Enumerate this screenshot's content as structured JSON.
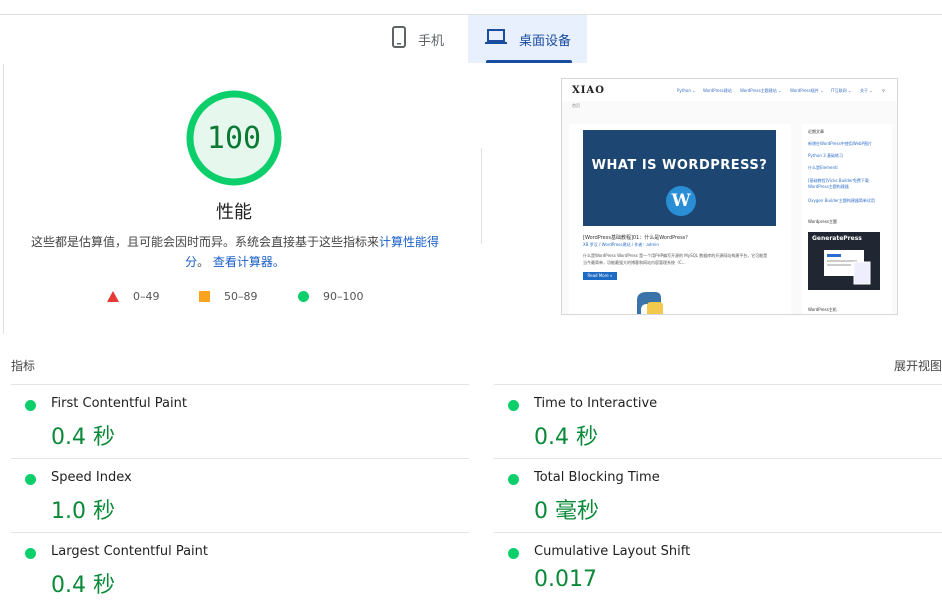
{
  "tabs": {
    "mobile_label": "手机",
    "desktop_label": "桌面设备"
  },
  "score": {
    "value": "100",
    "title": "性能",
    "desc_prefix": "这些都是估算值，且可能会因时而异。系统会直接基于这些指标来",
    "desc_link": "计算性能得分",
    "desc_mid": "。",
    "desc_link2": "查看计算器。"
  },
  "legend": [
    {
      "label": "0–49",
      "color": "#e53935",
      "shape": "triangle"
    },
    {
      "label": "50–89",
      "color": "#fba31e",
      "shape": "square"
    },
    {
      "label": "90–100",
      "color": "#0cce6b",
      "shape": "circle"
    }
  ],
  "metrics_header": {
    "title": "指标",
    "expand": "展开视图"
  },
  "metrics": [
    {
      "name": "First Contentful Paint",
      "value": "0.4 秒"
    },
    {
      "name": "Time to Interactive",
      "value": "0.4 秒"
    },
    {
      "name": "Speed Index",
      "value": "1.0 秒"
    },
    {
      "name": "Total Blocking Time",
      "value": "0 毫秒"
    },
    {
      "name": "Largest Contentful Paint",
      "value": "0.4 秒"
    },
    {
      "name": "Cumulative Layout Shift",
      "value": "0.017"
    }
  ],
  "screenshot": {
    "logo": "XIAO",
    "menu": [
      "Python ⌄",
      "WordPress建站",
      "WordPress主题建站 ⌄",
      "WordPress插件 ⌄",
      "IT互联网 ⌄",
      "关于 ⌄"
    ],
    "crumb": "首页",
    "hero_title": "WHAT IS WORDPRESS?",
    "post_title": "[WordPress基础教程]01：什么是WordPress？",
    "post_meta": "XB 罗汉 / WordPress建站 / 作者：admin",
    "excerpt_1": "什么是WordPress      WordPress 是一个用PHP编写开源的 MySQL 数据库的开源网站构建平台，它可能是",
    "excerpt_2": "当今最简单，功能最强大的博客和网站内容管理系统（C...",
    "read_more": "Read More »",
    "side_title": "近期文章",
    "side_links": [
      "新增在WordPress中使用WebP图片",
      "Python 3 基础练习",
      "什么是Elementi",
      "[基础教程]Vicks Builder免费下载WordPress主题构建器",
      "Oxygen Builder主题构建器简单试用"
    ],
    "side_section": "Wordpress主题",
    "gp_name": "GeneratePress",
    "side_footer": "WordPress主机"
  },
  "colors": {
    "pass": "#0cce6b",
    "pass_text": "#0a8a38",
    "average": "#fba31e",
    "fail": "#e53935",
    "accent": "#1a4ca0"
  }
}
